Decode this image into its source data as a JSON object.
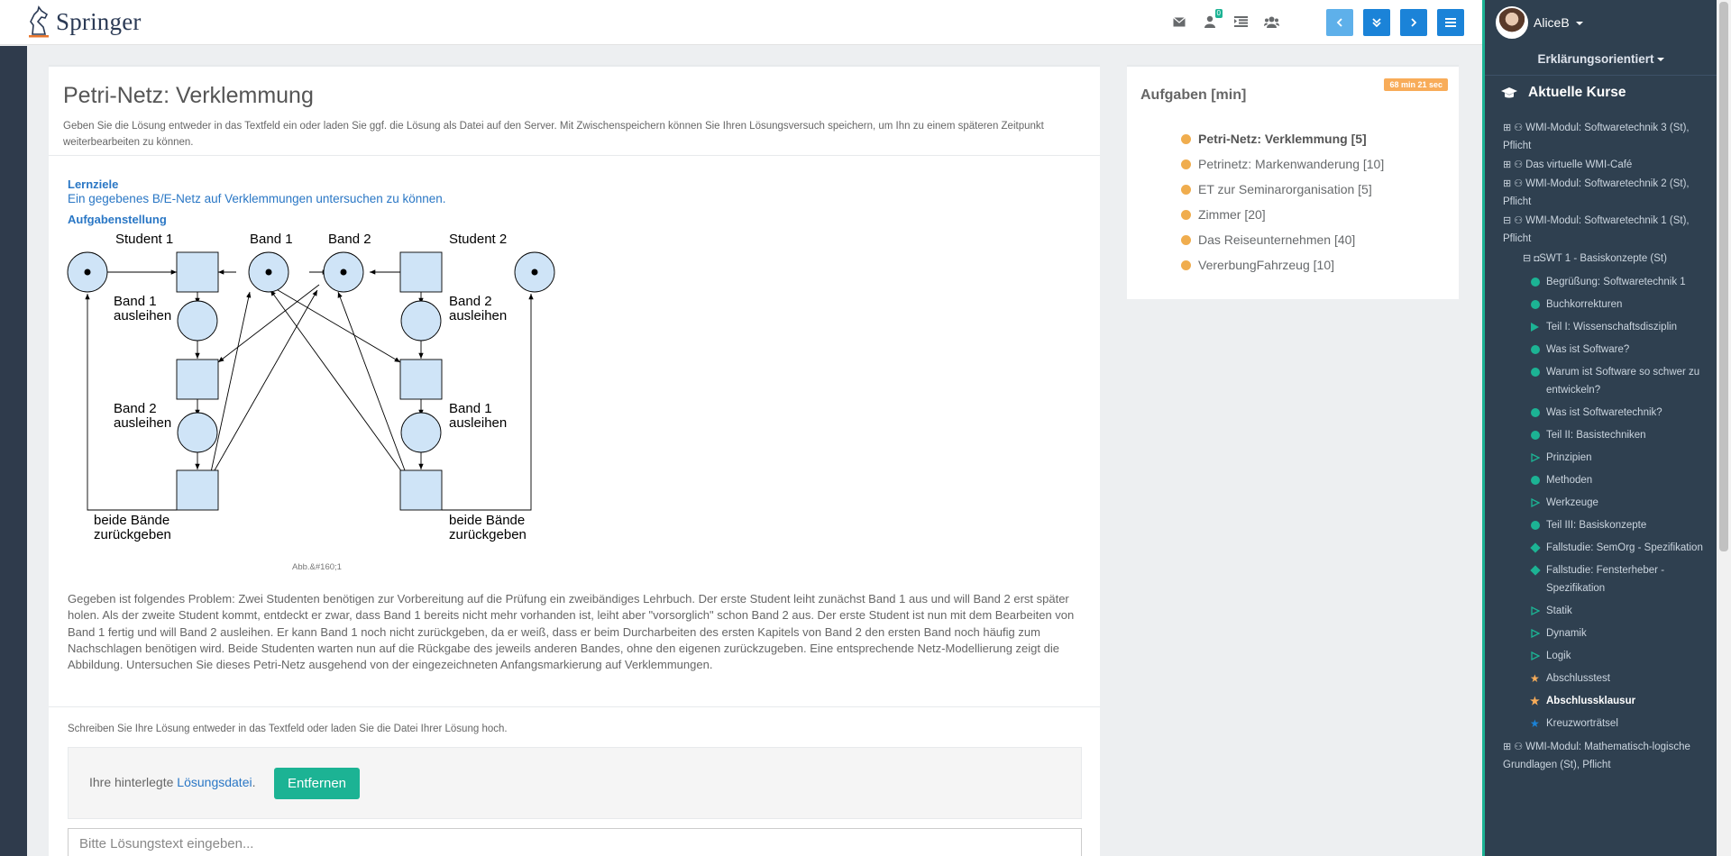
{
  "brand": {
    "name": "Springer"
  },
  "topbar": {
    "mail_badge": "0",
    "icons": [
      "envelope-icon",
      "user-badge-icon",
      "list-indent-icon",
      "users-icon"
    ]
  },
  "nav": {
    "buttons": [
      "chevron-left-icon",
      "double-chevron-down-icon",
      "chevron-right-icon",
      "hamburger-icon"
    ]
  },
  "main": {
    "title": "Petri-Netz: Verklemmung",
    "intro": "Geben Sie die Lösung entweder in das Textfeld ein oder laden Sie ggf. die Lösung als Datei auf den Server. Mit Zwischenspeichern können Sie Ihren Lösungsversuch speichern, um Ihn zu einem späteren Zeitpunkt weiterbearbeiten zu können.",
    "lernziele_heading": "Lernziele",
    "lernziele_text": "Ein gegebenes B/E-Netz auf Verklemmungen untersuchen zu können.",
    "aufgabe_heading": "Aufgabenstellung",
    "figure_caption": "Abb.&#160;1",
    "problem": "Gegeben ist folgendes Problem: Zwei Studenten benötigen zur Vorbereitung auf die Prüfung ein zweibändiges Lehrbuch. Der erste Student leiht zunächst Band 1 aus und will Band 2 erst später holen. Als der zweite Student kommt, entdeckt er zwar, dass Band 1 bereits nicht mehr vorhanden ist, leiht aber \"vorsorglich\" schon Band 2 aus. Der erste Student ist nun mit dem Bearbeiten von Band 1 fertig und will Band 2 ausleihen. Er kann Band 1 noch nicht zurückgeben, da er weiß, dass er beim Durcharbeiten des ersten Kapitels von Band 2 den ersten Band noch häufig zum Nachschlagen benötigen wird. Beide Studenten warten nun auf die Rückgabe des jeweils anderen Bandes, ohne den eigenen zurückzugeben. Eine entsprechende Netz-Modellierung zeigt die Abbildung. Untersuchen Sie dieses Petri-Netz ausgehend von der eingezeichneten Anfangsmarkierung auf Verklemmungen.",
    "hint": "Schreiben Sie Ihre Lösung entweder in das Textfeld oder laden Sie die Datei Ihrer Lösung hoch.",
    "file_prefix": "Ihre hinterlegte ",
    "file_link": "Lösungsdatei",
    "file_suffix": ".",
    "remove_label": "Entfernen",
    "textarea_placeholder": "Bitte Lösungstext eingeben..."
  },
  "diagram": {
    "labels": {
      "student1": "Student 1",
      "band1": "Band 1",
      "band2": "Band 2",
      "student2": "Student 2",
      "t1a": "Band 1",
      "t1b": "ausleihen",
      "t2a": "Band 2",
      "t2b": "ausleihen",
      "t3a": "beide Bände",
      "t3b": "zurückgeben",
      "u1a": "Band 2",
      "u1b": "ausleihen",
      "u2a": "Band 1",
      "u2b": "ausleihen",
      "u3a": "beide Bände",
      "u3b": "zurückgeben"
    }
  },
  "tasks": {
    "heading": "Aufgaben [min]",
    "timer": "68 min 21 sec",
    "items": [
      {
        "label": "Petri-Netz: Verklemmung [5]"
      },
      {
        "label": "Petrinetz: Markenwanderung [10]"
      },
      {
        "label": "ET zur Seminarorganisation [5]"
      },
      {
        "label": "Zimmer [20]"
      },
      {
        "label": "Das Reiseunternehmen [40]"
      },
      {
        "label": "VererbungFahrzeug [10]"
      }
    ]
  },
  "sidebar": {
    "user": "AliceB",
    "mode": "Erklärungsorientiert",
    "courses_heading": "Aktuelle Kurse",
    "courses": [
      {
        "box": "⊞",
        "label": "WMI-Modul: Softwaretechnik 3 (St), Pflicht"
      },
      {
        "box": "⊞",
        "label": "Das virtuelle WMI-Café"
      },
      {
        "box": "⊞",
        "label": "WMI-Modul: Softwaretechnik 2 (St), Pflicht"
      },
      {
        "box": "⊟",
        "label": "WMI-Modul: Softwaretechnik 1 (St), Pflicht"
      }
    ],
    "sub": {
      "box": "⊟",
      "label": "SWT 1 - Basiskonzepte (St)"
    },
    "lessons": [
      {
        "label": "Begrüßung: Softwaretechnik 1",
        "mark": "circle"
      },
      {
        "label": "Buchkorrekturen",
        "mark": "circle"
      },
      {
        "label": "Teil I: Wissenschaftsdisziplin",
        "mark": "triangle"
      },
      {
        "label": "Was ist Software?",
        "mark": "circle"
      },
      {
        "label": "Warum ist Software so schwer zu entwickeln?",
        "mark": "circle"
      },
      {
        "label": "Was ist Softwaretechnik?",
        "mark": "circle"
      },
      {
        "label": "Teil II: Basistechniken",
        "mark": "circle"
      },
      {
        "label": "Prinzipien",
        "mark": "triangle-outline"
      },
      {
        "label": "Methoden",
        "mark": "circle"
      },
      {
        "label": "Werkzeuge",
        "mark": "triangle-outline"
      },
      {
        "label": "Teil III: Basiskonzepte",
        "mark": "circle"
      },
      {
        "label": "Fallstudie: SemOrg - Spezifikation",
        "mark": "diamond"
      },
      {
        "label": "Fallstudie: Fensterheber - Spezifikation",
        "mark": "diamond"
      },
      {
        "label": "Statik",
        "mark": "triangle-outline"
      },
      {
        "label": "Dynamik",
        "mark": "triangle-outline"
      },
      {
        "label": "Logik",
        "mark": "triangle-outline"
      },
      {
        "label": "Abschlusstest",
        "mark": "star-orange"
      },
      {
        "label": "Abschlussklausur",
        "mark": "star-orange"
      },
      {
        "label": "Kreuzworträtsel",
        "mark": "star-blue"
      }
    ],
    "last_course": {
      "box": "⊞",
      "label": "WMI-Modul: Mathematisch-logische Grundlagen (St), Pflicht"
    }
  },
  "colors": {
    "accent": "#1cb394",
    "primary": "#1b83d8",
    "link": "#2a77c5",
    "sidebar": "#2f4050",
    "warning": "#f8ac59"
  }
}
